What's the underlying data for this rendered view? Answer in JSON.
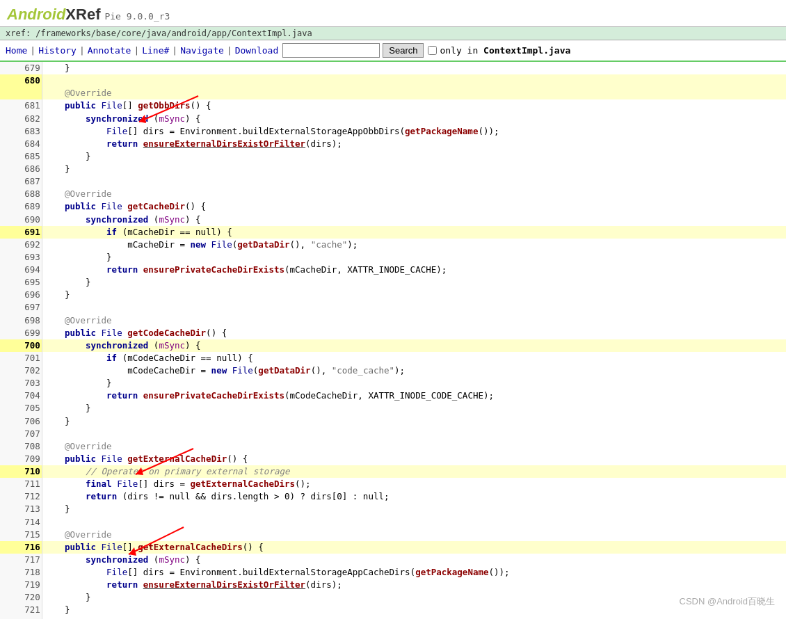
{
  "logo": {
    "android": "Android",
    "xref": "XRef",
    "version": "Pie 9.0.0_r3"
  },
  "breadcrumb": "xref: /frameworks/base/core/java/android/app/ContextImpl.java",
  "nav": {
    "home": "Home",
    "history": "History",
    "annotate": "Annotate",
    "linenum": "Line#",
    "navigate": "Navigate",
    "download": "Download",
    "search_placeholder": "",
    "search_button": "Search",
    "only_label": "only in",
    "only_file": "ContextImpl.java"
  },
  "watermark": "CSDN @Android百晓生"
}
